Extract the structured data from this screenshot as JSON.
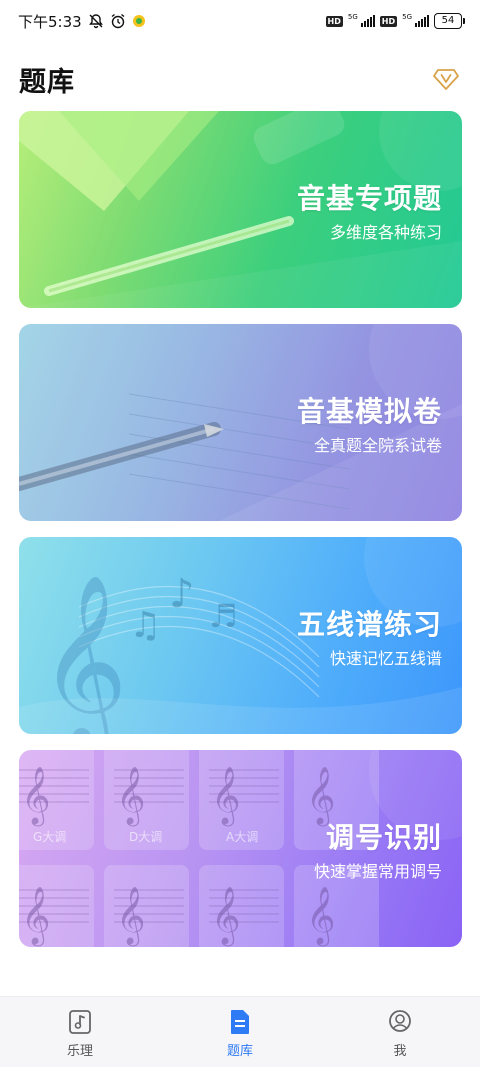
{
  "status_bar": {
    "time": "下午5:33",
    "network_1": "5G",
    "network_2": "5G",
    "hd_label": "HD",
    "battery": "54"
  },
  "header": {
    "title": "题库"
  },
  "cards": [
    {
      "title": "音基专项题",
      "subtitle": "多维度各种练习"
    },
    {
      "title": "音基模拟卷",
      "subtitle": "全真题全院系试卷"
    },
    {
      "title": "五线谱练习",
      "subtitle": "快速记忆五线谱"
    },
    {
      "title": "调号识别",
      "subtitle": "快速掌握常用调号"
    }
  ],
  "key_tiles": [
    "G大调",
    "D大调",
    "A大调"
  ],
  "tabbar": {
    "items": [
      {
        "label": "乐理",
        "icon": "music-note-icon"
      },
      {
        "label": "题库",
        "icon": "document-icon"
      },
      {
        "label": "我",
        "icon": "user-icon"
      }
    ],
    "active_index": 1,
    "active_color": "#2f7bf6"
  }
}
